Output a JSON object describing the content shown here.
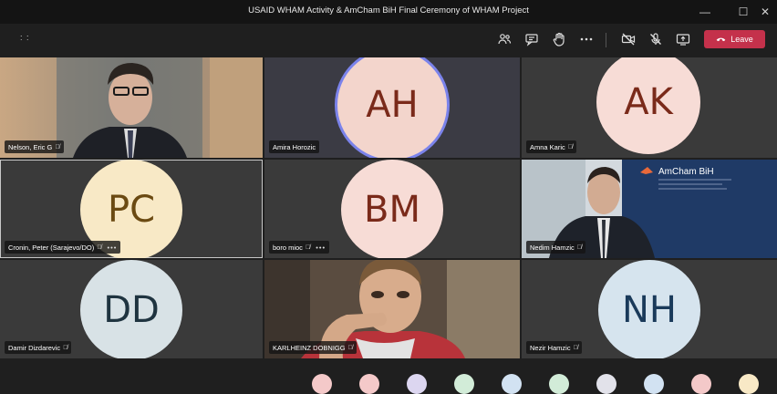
{
  "window": {
    "title": "USAID WHAM Activity & AmCham BiH Final Ceremony of WHAM Project",
    "minimize": "—",
    "maximize": "☐",
    "close": "✕"
  },
  "toolbar": {
    "timer": ": :",
    "icons": [
      "participants-icon",
      "chat-icon",
      "raise-hand-icon",
      "more-icon",
      "camera-off-icon",
      "mic-off-icon",
      "share-icon"
    ],
    "leave_label": "Leave"
  },
  "participants": [
    {
      "name": "Nelson, Eric G",
      "type": "video",
      "muted": true,
      "more": false
    },
    {
      "name": "Amira Horozic",
      "initials": "AH",
      "type": "avatar",
      "muted": false,
      "more": false,
      "speaking": true
    },
    {
      "name": "Amna Karic",
      "initials": "AK",
      "type": "avatar",
      "muted": true,
      "more": false
    },
    {
      "name": "Cronin, Peter (Sarajevo/DO)",
      "initials": "PC",
      "type": "avatar",
      "muted": true,
      "more": true,
      "selected": true
    },
    {
      "name": "boro mioc",
      "initials": "BM",
      "type": "avatar",
      "muted": true,
      "more": true
    },
    {
      "name": "Nedim Hamzic",
      "type": "video",
      "muted": true,
      "more": false
    },
    {
      "name": "Damir Dizdarevic",
      "initials": "DD",
      "type": "avatar",
      "muted": true,
      "more": false
    },
    {
      "name": "KARLHEINZ DOBNIGG",
      "type": "video",
      "muted": true,
      "more": false
    },
    {
      "name": "Nezir Hamzic",
      "initials": "NH",
      "type": "avatar",
      "muted": true,
      "more": false
    }
  ],
  "banner": {
    "brand": "AmCham BiH"
  },
  "colors": {
    "leave": "#c4314b",
    "avatar_ah_bg": "#f3d5cc",
    "avatar_ah_fg": "#7a2a1a",
    "avatar_ak_bg": "#f7dcd6",
    "avatar_ak_fg": "#7a2a1a",
    "avatar_pc_bg": "#f8e9c6",
    "avatar_pc_fg": "#6b4a12",
    "avatar_bm_bg": "#f7dcd6",
    "avatar_bm_fg": "#7a2a1a",
    "avatar_dd_bg": "#d8e2e6",
    "avatar_dd_fg": "#1f3440",
    "avatar_nh_bg": "#d6e4ee",
    "avatar_nh_fg": "#1a3a5a"
  }
}
